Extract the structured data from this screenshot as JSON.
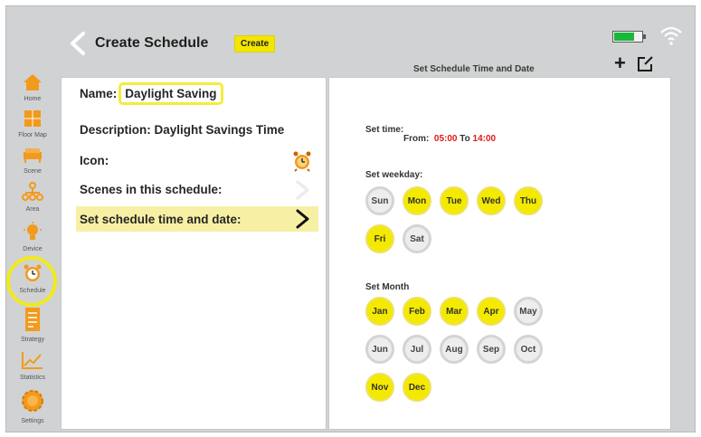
{
  "header": {
    "title": "Create Schedule",
    "create_label": "Create",
    "subtitle": "Set Schedule Time and Date",
    "add_label": "+"
  },
  "sidebar": {
    "items": [
      {
        "label": "Home",
        "icon": "home-icon"
      },
      {
        "label": "Floor Map",
        "icon": "floor-map-icon"
      },
      {
        "label": "Scene",
        "icon": "scene-icon"
      },
      {
        "label": "Area",
        "icon": "area-icon"
      },
      {
        "label": "Device",
        "icon": "device-icon"
      },
      {
        "label": "Schedule",
        "icon": "schedule-icon",
        "active": true
      },
      {
        "label": "Strategy",
        "icon": "strategy-icon"
      },
      {
        "label": "Statistics",
        "icon": "statistics-icon"
      },
      {
        "label": "Settings",
        "icon": "settings-icon"
      }
    ]
  },
  "details": {
    "name_label": "Name:",
    "name_value": "Daylight Saving",
    "description": "Description: Daylight Savings Time",
    "icon_label": "Icon:",
    "scenes_label": "Scenes in this schedule:",
    "time_date_label": "Set schedule time and date:"
  },
  "schedule": {
    "time_label": "Set time:",
    "from_label": "From:",
    "from_value": "05:00",
    "to_label": "To",
    "to_value": "14:00",
    "weekday_label": "Set weekday:",
    "weekdays": [
      {
        "label": "Sun",
        "selected": false
      },
      {
        "label": "Mon",
        "selected": true
      },
      {
        "label": "Tue",
        "selected": true
      },
      {
        "label": "Wed",
        "selected": true
      },
      {
        "label": "Thu",
        "selected": true
      },
      {
        "label": "Fri",
        "selected": true
      },
      {
        "label": "Sat",
        "selected": false
      }
    ],
    "month_label": "Set Month",
    "months": [
      {
        "label": "Jan",
        "selected": true
      },
      {
        "label": "Feb",
        "selected": true
      },
      {
        "label": "Mar",
        "selected": true
      },
      {
        "label": "Apr",
        "selected": true
      },
      {
        "label": "May",
        "selected": false
      },
      {
        "label": "Jun",
        "selected": false
      },
      {
        "label": "Jul",
        "selected": false
      },
      {
        "label": "Aug",
        "selected": false
      },
      {
        "label": "Sep",
        "selected": false
      },
      {
        "label": "Oct",
        "selected": false
      },
      {
        "label": "Nov",
        "selected": true
      },
      {
        "label": "Dec",
        "selected": true
      }
    ]
  },
  "colors": {
    "accent_yellow": "#f3ea00",
    "battery_green": "#18b83a",
    "time_red": "#e01818",
    "sidebar_orange": "#f29a1c"
  }
}
